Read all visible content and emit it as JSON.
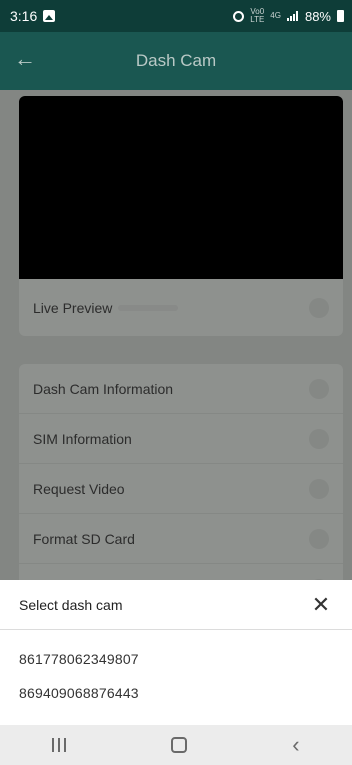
{
  "status_bar": {
    "time": "3:16",
    "network_top": "Vo0",
    "network_bottom": "LTE",
    "network_type": "4G",
    "battery": "88%"
  },
  "app_bar": {
    "title": "Dash Cam",
    "back_icon": "arrow-left-icon"
  },
  "live_preview": {
    "label": "Live Preview"
  },
  "menu": {
    "items": [
      {
        "label": "Dash Cam Information"
      },
      {
        "label": "SIM Information"
      },
      {
        "label": "Request Video"
      },
      {
        "label": "Format SD Card"
      }
    ]
  },
  "sheet": {
    "title": "Select dash cam",
    "close_icon": "close-icon",
    "options": [
      {
        "label": "861778062349807"
      },
      {
        "label": "869409068876443"
      }
    ]
  },
  "colors": {
    "status_bar": "#0e3d38",
    "app_bar": "#1a5751",
    "overlay_background": "#838683",
    "sheet_background": "#ffffff"
  }
}
